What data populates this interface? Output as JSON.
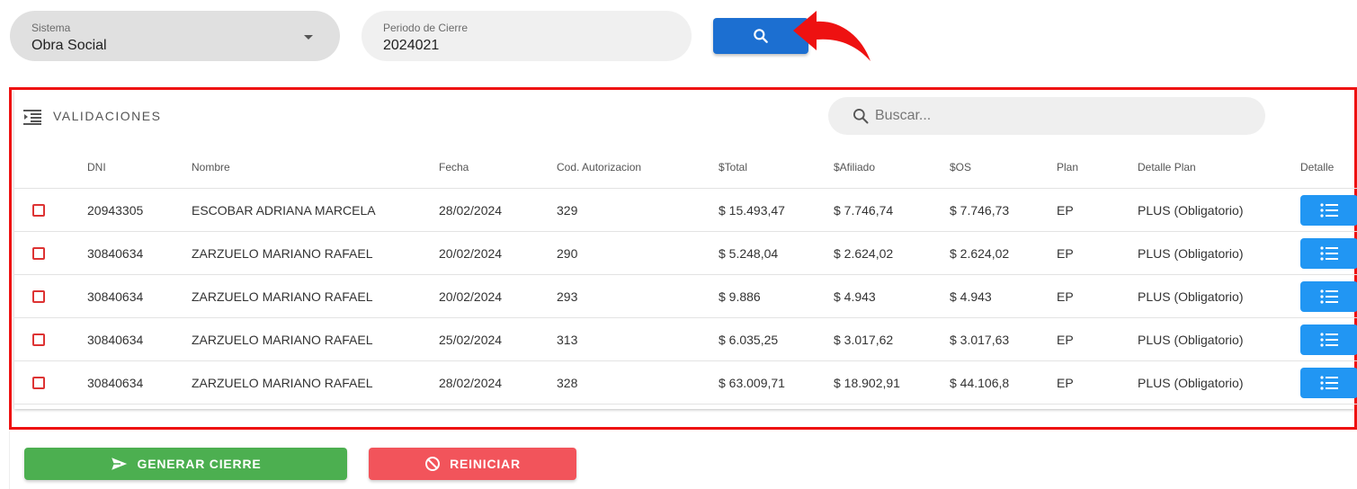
{
  "filters": {
    "sistema": {
      "label": "Sistema",
      "value": "Obra Social"
    },
    "periodo": {
      "label": "Periodo de Cierre",
      "value": "2024021"
    }
  },
  "section": {
    "title": "VALIDACIONES",
    "search_placeholder": "Buscar..."
  },
  "table": {
    "headers": {
      "dni": "DNI",
      "nombre": "Nombre",
      "fecha": "Fecha",
      "cod": "Cod. Autorizacion",
      "total": "$Total",
      "afiliado": "$Afiliado",
      "os": "$OS",
      "plan": "Plan",
      "detalle_plan": "Detalle Plan",
      "detalle": "Detalle"
    },
    "rows": [
      {
        "dni": "20943305",
        "nombre": "ESCOBAR ADRIANA MARCELA",
        "fecha": "28/02/2024",
        "cod": "329",
        "total": "$ 15.493,47",
        "afiliado": "$ 7.746,74",
        "os": "$ 7.746,73",
        "plan": "EP",
        "detalle_plan": "PLUS (Obligatorio)"
      },
      {
        "dni": "30840634",
        "nombre": "ZARZUELO MARIANO RAFAEL",
        "fecha": "20/02/2024",
        "cod": "290",
        "total": "$ 5.248,04",
        "afiliado": "$ 2.624,02",
        "os": "$ 2.624,02",
        "plan": "EP",
        "detalle_plan": "PLUS (Obligatorio)"
      },
      {
        "dni": "30840634",
        "nombre": "ZARZUELO MARIANO RAFAEL",
        "fecha": "20/02/2024",
        "cod": "293",
        "total": "$ 9.886",
        "afiliado": "$ 4.943",
        "os": "$ 4.943",
        "plan": "EP",
        "detalle_plan": "PLUS (Obligatorio)"
      },
      {
        "dni": "30840634",
        "nombre": "ZARZUELO MARIANO RAFAEL",
        "fecha": "25/02/2024",
        "cod": "313",
        "total": "$ 6.035,25",
        "afiliado": "$ 3.017,62",
        "os": "$ 3.017,63",
        "plan": "EP",
        "detalle_plan": "PLUS (Obligatorio)"
      },
      {
        "dni": "30840634",
        "nombre": "ZARZUELO MARIANO RAFAEL",
        "fecha": "28/02/2024",
        "cod": "328",
        "total": "$ 63.009,71",
        "afiliado": "$ 18.902,91",
        "os": "$ 44.106,8",
        "plan": "EP",
        "detalle_plan": "PLUS (Obligatorio)"
      }
    ]
  },
  "actions": {
    "generar_label": "GENERAR CIERRE",
    "reiniciar_label": "REINICIAR"
  },
  "icons": {
    "search": "search-icon",
    "list_indent": "list-indent-icon",
    "detail": "list-icon",
    "send": "send-icon",
    "block": "block-icon"
  },
  "colors": {
    "primary": "#1c6fd1",
    "detail_button": "#2196f3",
    "success": "#4caf50",
    "danger": "#f2545b",
    "annotation": "#ee1111"
  }
}
